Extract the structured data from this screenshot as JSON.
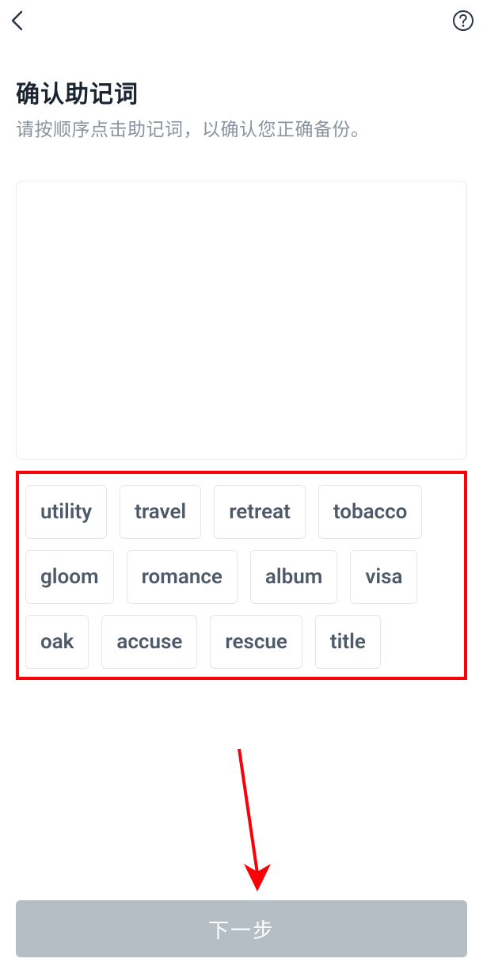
{
  "header": {
    "title": "确认助记词",
    "subtitle": "请按顺序点击助记词，以确认您正确备份。"
  },
  "mnemonic": {
    "words": [
      "utility",
      "travel",
      "retreat",
      "tobacco",
      "gloom",
      "romance",
      "album",
      "visa",
      "oak",
      "accuse",
      "rescue",
      "title"
    ]
  },
  "footer": {
    "next_label": "下一步"
  },
  "colors": {
    "annotation": "#fb0007",
    "button_bg": "#b5bdc5",
    "text_primary": "#1b2431",
    "text_secondary": "#8a939f",
    "chip_text": "#4e5a6a"
  }
}
